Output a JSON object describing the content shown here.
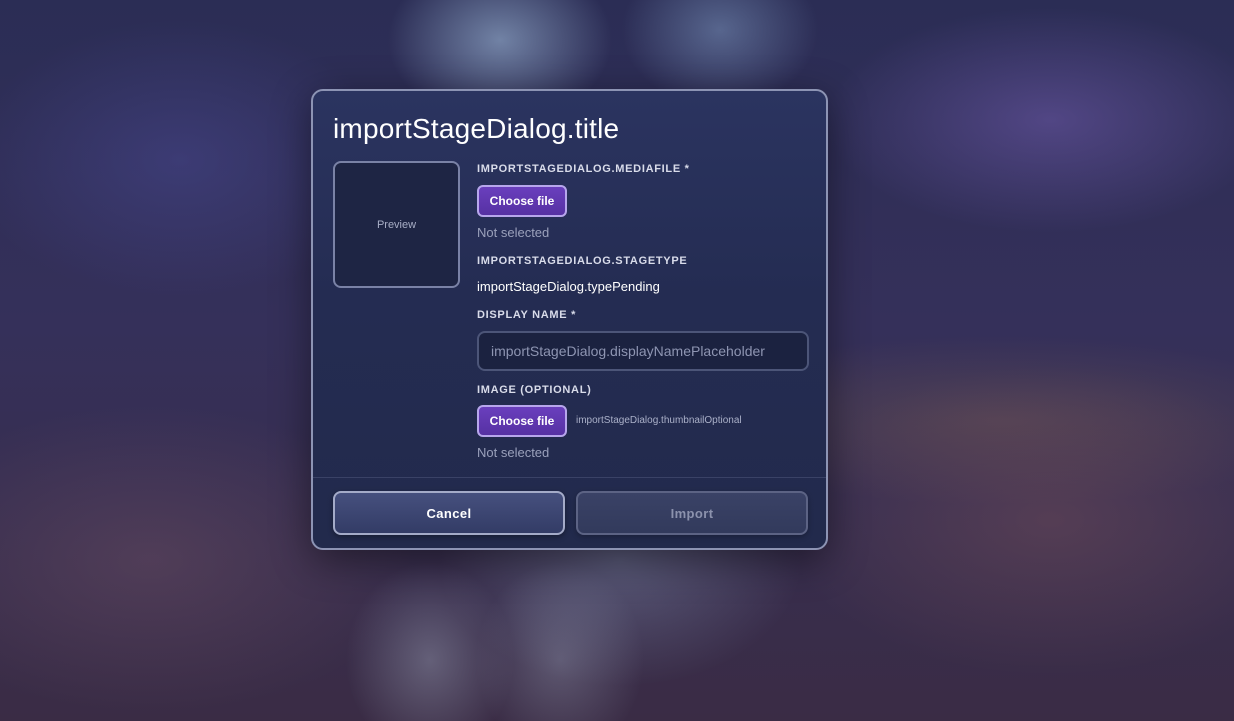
{
  "dialog": {
    "title": "importStageDialog.title",
    "preview_label": "Preview",
    "media_file": {
      "label": "IMPORTSTAGEDIALOG.MEDIAFILE *",
      "button_label": "Choose file",
      "status": "Not selected"
    },
    "stage_type": {
      "label": "IMPORTSTAGEDIALOG.STAGETYPE",
      "value": "importStageDialog.typePending"
    },
    "display_name": {
      "label": "DISPLAY NAME *",
      "value": "",
      "placeholder": "importStageDialog.displayNamePlaceholder"
    },
    "image": {
      "label": "IMAGE (OPTIONAL)",
      "button_label": "Choose file",
      "hint": "importStageDialog.thumbnailOptional",
      "status": "Not selected"
    },
    "actions": {
      "cancel_label": "Cancel",
      "import_label": "Import"
    }
  },
  "colors": {
    "accent_button": "#5631a3",
    "dialog_background": "#242c52",
    "dialog_border": "#8d94b4"
  }
}
